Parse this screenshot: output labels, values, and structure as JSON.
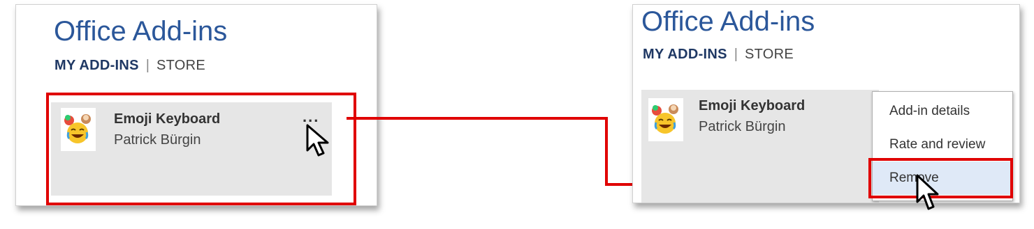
{
  "left_panel": {
    "title": "Office Add-ins",
    "nav": {
      "my_addins": "MY ADD-INS",
      "separator": "|",
      "store": "STORE"
    },
    "addin": {
      "name": "Emoji Keyboard",
      "author": "Patrick Bürgin",
      "icon": "emoji-laughing-icon"
    },
    "more_button": "..."
  },
  "right_panel": {
    "title": "Office Add-ins",
    "nav": {
      "my_addins": "MY ADD-INS",
      "separator": "|",
      "store": "STORE"
    },
    "addin": {
      "name": "Emoji Keyboard",
      "author": "Patrick Bürgin",
      "icon": "emoji-laughing-icon"
    },
    "context_menu": {
      "items": [
        "Add-in details",
        "Rate and review",
        "Remove"
      ],
      "hovered_item": "Remove"
    }
  },
  "colors": {
    "title": "#2b579a",
    "highlight": "#e00000",
    "card_bg": "#e6e6e6",
    "menu_hover": "#dfe9f7"
  },
  "icons": [
    "emoji-laughing-icon",
    "mouse-pointer-icon",
    "arrow-connector"
  ]
}
